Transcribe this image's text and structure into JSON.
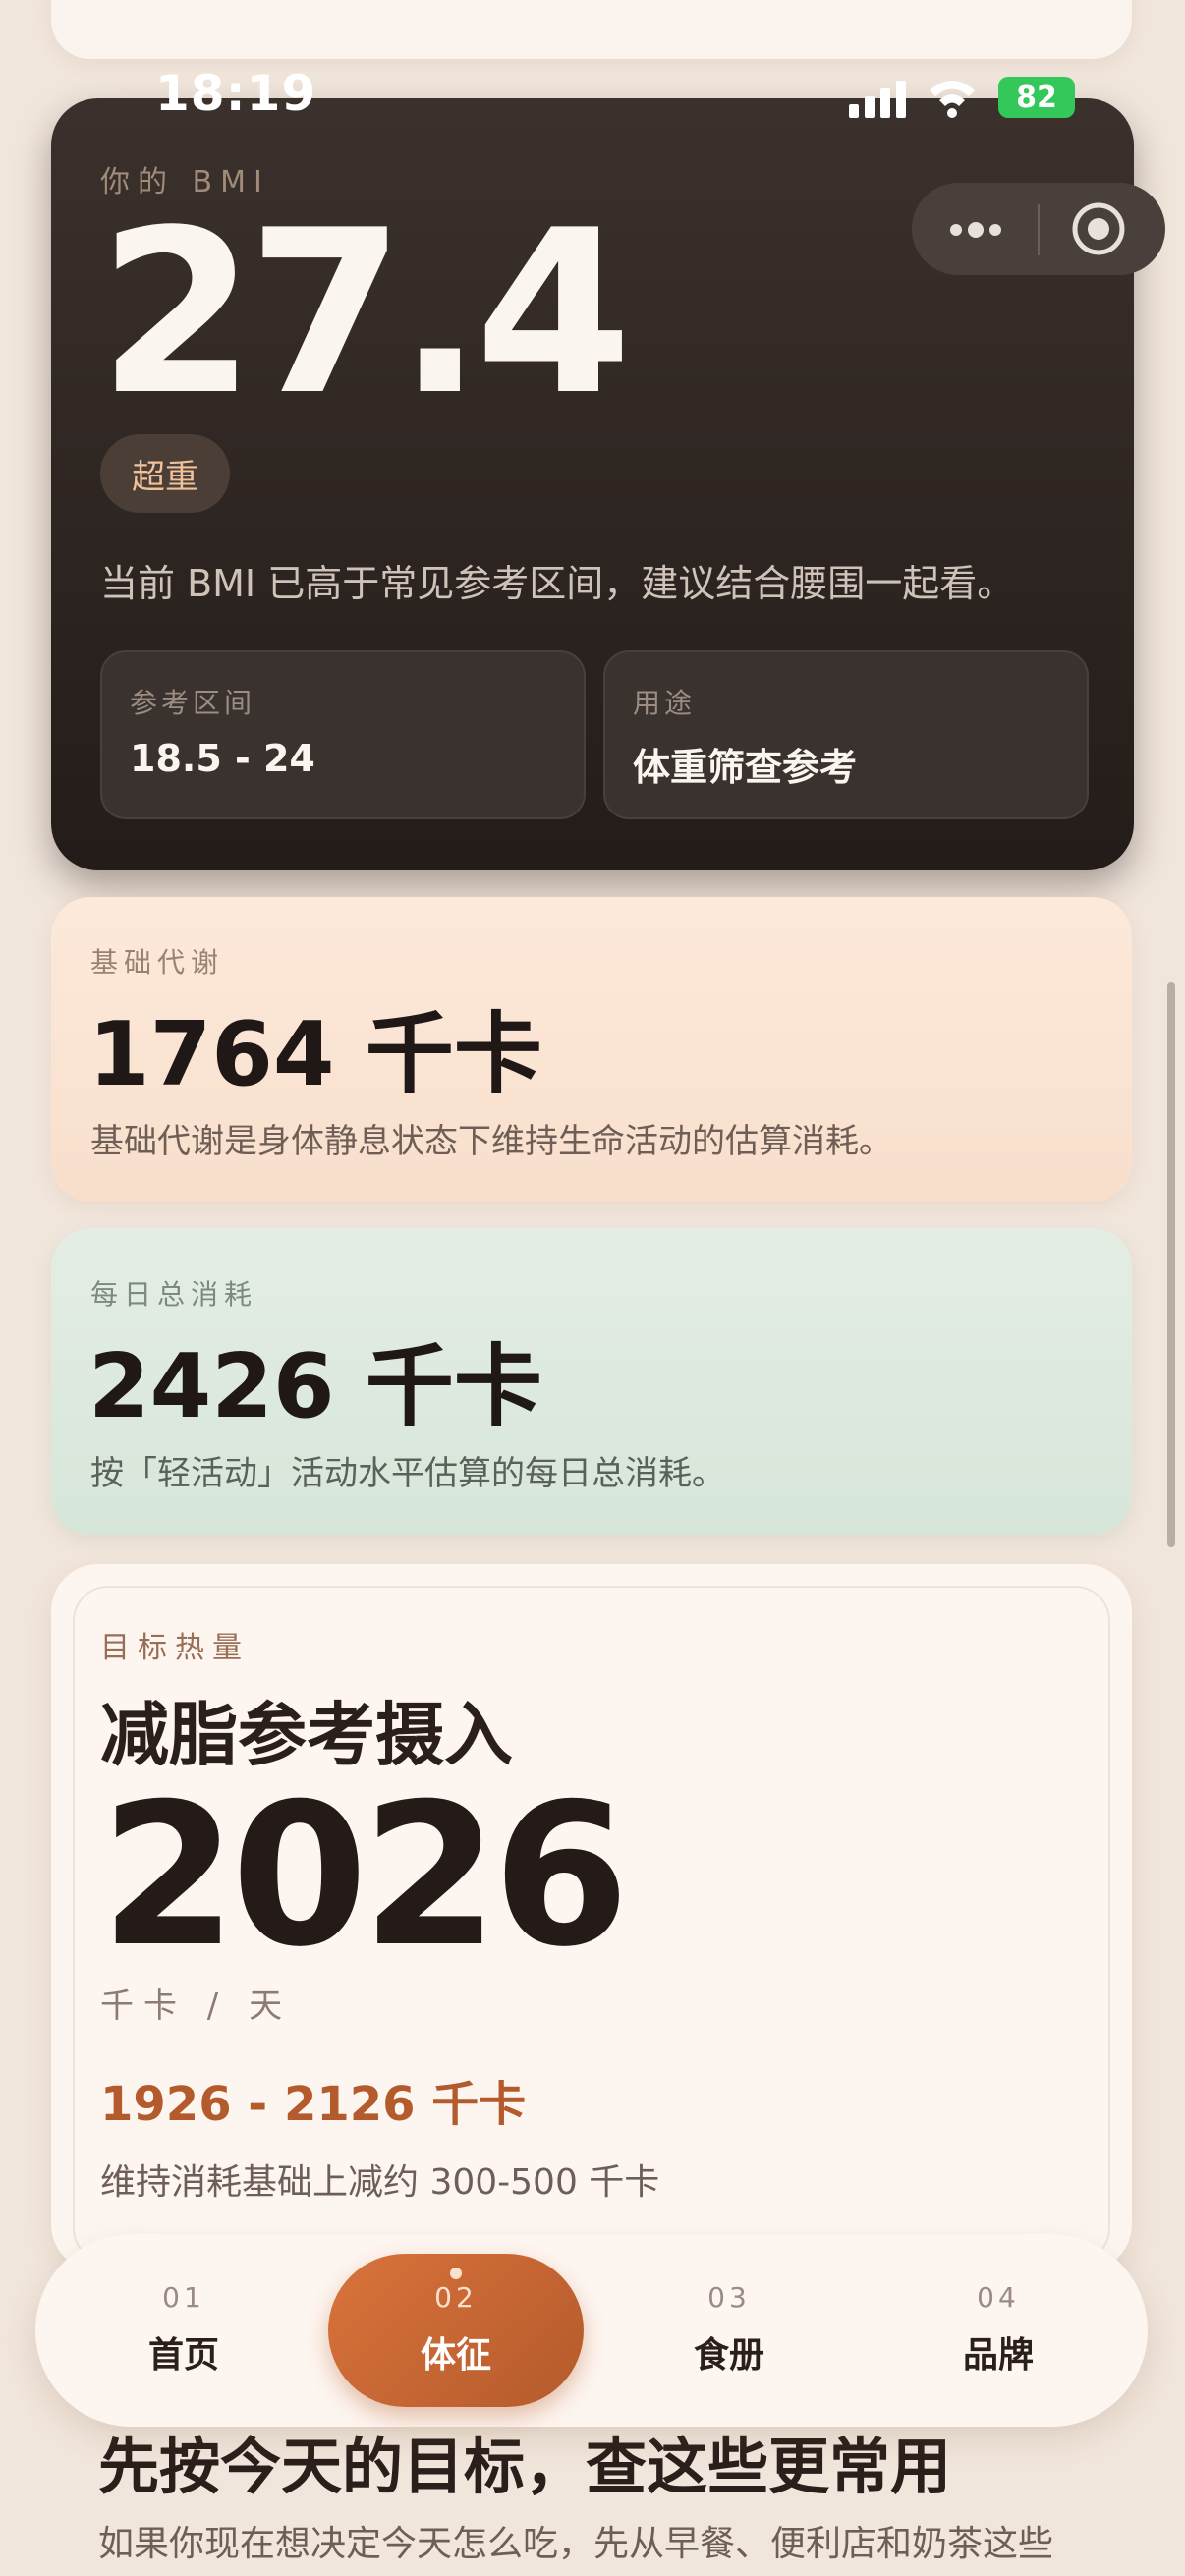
{
  "status_bar": {
    "time": "18:19",
    "battery": "82"
  },
  "bmi": {
    "eyebrow": "你的 BMI",
    "value": "27.4",
    "badge": "超重",
    "description": "当前 BMI 已高于常见参考区间，建议结合腰围一起看。",
    "range_label": "参考区间",
    "range_value": "18.5 - 24",
    "use_label": "用途",
    "use_value": "体重筛查参考"
  },
  "bmr": {
    "label": "基础代谢",
    "value": "1764 千卡",
    "description": "基础代谢是身体静息状态下维持生命活动的估算消耗。"
  },
  "tdee": {
    "label": "每日总消耗",
    "value": "2426 千卡",
    "description": "按「轻活动」活动水平估算的每日总消耗。"
  },
  "target": {
    "eyebrow": "目标热量",
    "title": "减脂参考摄入",
    "value": "2026",
    "unit": "千卡 / 天",
    "range": "1926 - 2126 千卡",
    "note": "维持消耗基础上减约 300-500 千卡"
  },
  "next_section": {
    "heading": "先按今天的目标，查这些更常用",
    "text": "如果你现在想决定今天怎么吃，先从早餐、便利店和奶茶这些"
  },
  "tabbar": {
    "items": [
      {
        "num": "01",
        "label": "首页"
      },
      {
        "num": "02",
        "label": "体征"
      },
      {
        "num": "03",
        "label": "食册"
      },
      {
        "num": "04",
        "label": "品牌"
      }
    ],
    "active_index": 1,
    "accent_color": "#c8642f"
  }
}
